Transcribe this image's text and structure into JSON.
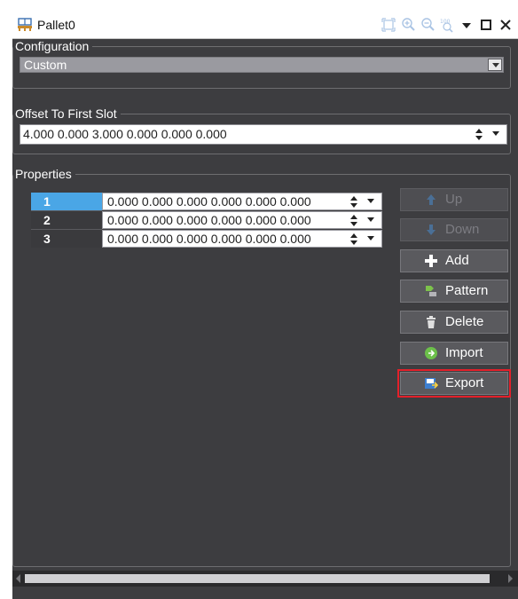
{
  "window": {
    "title": "Pallet0",
    "titlebar_icons": [
      "fit-view-icon",
      "zoom-in-icon",
      "zoom-out-icon",
      "zoom-100-icon",
      "pin-dropdown-icon",
      "maximize-icon",
      "close-icon"
    ]
  },
  "configuration": {
    "legend": "Configuration",
    "selected": "Custom"
  },
  "offset": {
    "legend": "Offset To First Slot",
    "value": "4.000 0.000 3.000 0.000 0.000 0.000"
  },
  "properties": {
    "legend": "Properties",
    "rows": [
      {
        "index": "1",
        "value": "0.000 0.000 0.000 0.000 0.000 0.000",
        "selected": true
      },
      {
        "index": "2",
        "value": "0.000 0.000 0.000 0.000 0.000 0.000",
        "selected": false
      },
      {
        "index": "3",
        "value": "0.000 0.000 0.000 0.000 0.000 0.000",
        "selected": false
      }
    ],
    "buttons": {
      "up": "Up",
      "down": "Down",
      "add": "Add",
      "pattern": "Pattern",
      "delete": "Delete",
      "import": "Import",
      "export": "Export"
    }
  },
  "colors": {
    "panel_bg": "#3d3d40",
    "selected_row": "#4aa6e6",
    "highlight_outline": "#e3202a"
  }
}
